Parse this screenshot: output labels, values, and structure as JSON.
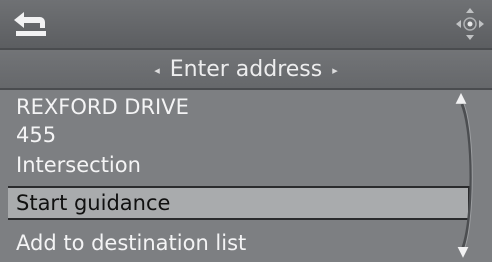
{
  "header": {
    "back_icon": "back-arrow-icon",
    "dial_icon": "controller-dial-icon"
  },
  "title": {
    "label": "Enter address"
  },
  "list": {
    "items": [
      {
        "label": "REXFORD DRIVE"
      },
      {
        "label": "455"
      },
      {
        "label": "Intersection"
      },
      {
        "label": "Start guidance",
        "selected": true
      },
      {
        "label": "Add to destination list"
      }
    ]
  },
  "colors": {
    "background": "#7d7f82",
    "selected_bg": "#a9abad",
    "text": "#f4f4f5",
    "selected_text": "#101010"
  }
}
